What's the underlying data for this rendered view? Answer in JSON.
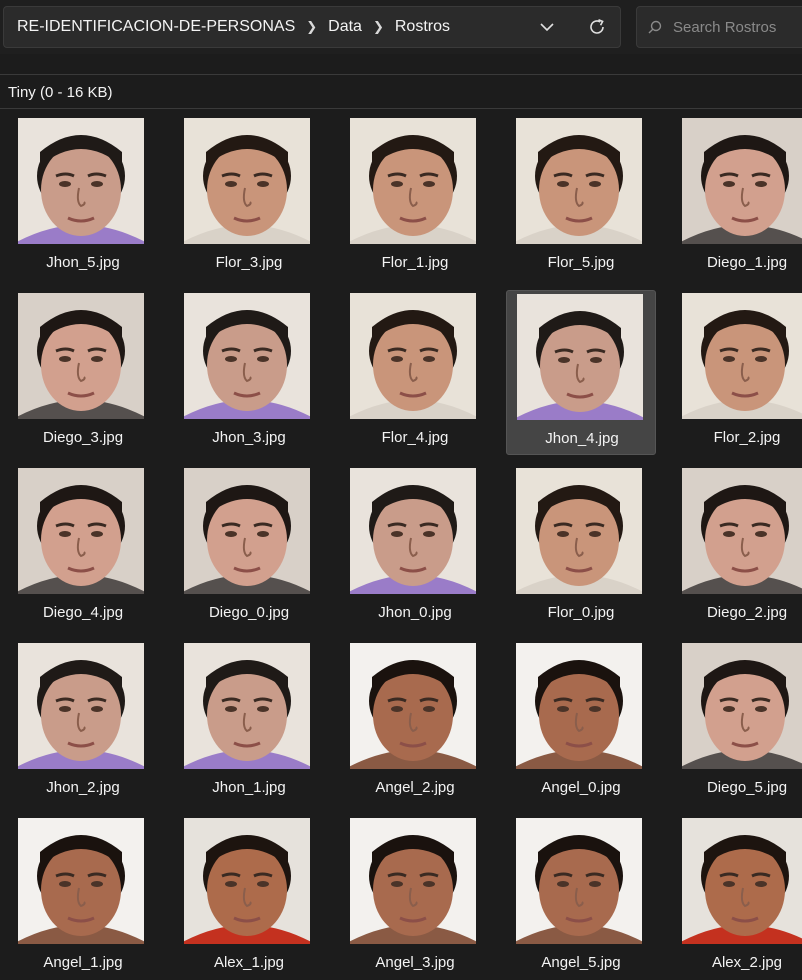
{
  "breadcrumb": [
    "RE-IDENTIFICACION-DE-PERSONAS",
    "Data",
    "Rostros"
  ],
  "search": {
    "placeholder": "Search Rostros"
  },
  "group": {
    "label": "Tiny (0 - 16 KB)"
  },
  "colors": {
    "background": "#1c1c1c",
    "selected": "#454545",
    "text": "#ffffff"
  },
  "files": [
    {
      "name": "Jhon_5.jpg",
      "person": "jhon"
    },
    {
      "name": "Flor_3.jpg",
      "person": "flor"
    },
    {
      "name": "Flor_1.jpg",
      "person": "flor"
    },
    {
      "name": "Flor_5.jpg",
      "person": "flor"
    },
    {
      "name": "Diego_1.jpg",
      "person": "diego"
    },
    {
      "name": "Diego_3.jpg",
      "person": "diego"
    },
    {
      "name": "Jhon_3.jpg",
      "person": "jhon"
    },
    {
      "name": "Flor_4.jpg",
      "person": "flor"
    },
    {
      "name": "Jhon_4.jpg",
      "person": "jhon",
      "selected": true
    },
    {
      "name": "Flor_2.jpg",
      "person": "flor"
    },
    {
      "name": "Diego_4.jpg",
      "person": "diego"
    },
    {
      "name": "Diego_0.jpg",
      "person": "diego"
    },
    {
      "name": "Jhon_0.jpg",
      "person": "jhon"
    },
    {
      "name": "Flor_0.jpg",
      "person": "flor"
    },
    {
      "name": "Diego_2.jpg",
      "person": "diego"
    },
    {
      "name": "Jhon_2.jpg",
      "person": "jhon"
    },
    {
      "name": "Jhon_1.jpg",
      "person": "jhon"
    },
    {
      "name": "Angel_2.jpg",
      "person": "angel"
    },
    {
      "name": "Angel_0.jpg",
      "person": "angel"
    },
    {
      "name": "Diego_5.jpg",
      "person": "diego"
    },
    {
      "name": "Angel_1.jpg",
      "person": "angel"
    },
    {
      "name": "Alex_1.jpg",
      "person": "alex"
    },
    {
      "name": "Angel_3.jpg",
      "person": "angel"
    },
    {
      "name": "Angel_5.jpg",
      "person": "angel"
    },
    {
      "name": "Alex_2.jpg",
      "person": "alex"
    }
  ]
}
